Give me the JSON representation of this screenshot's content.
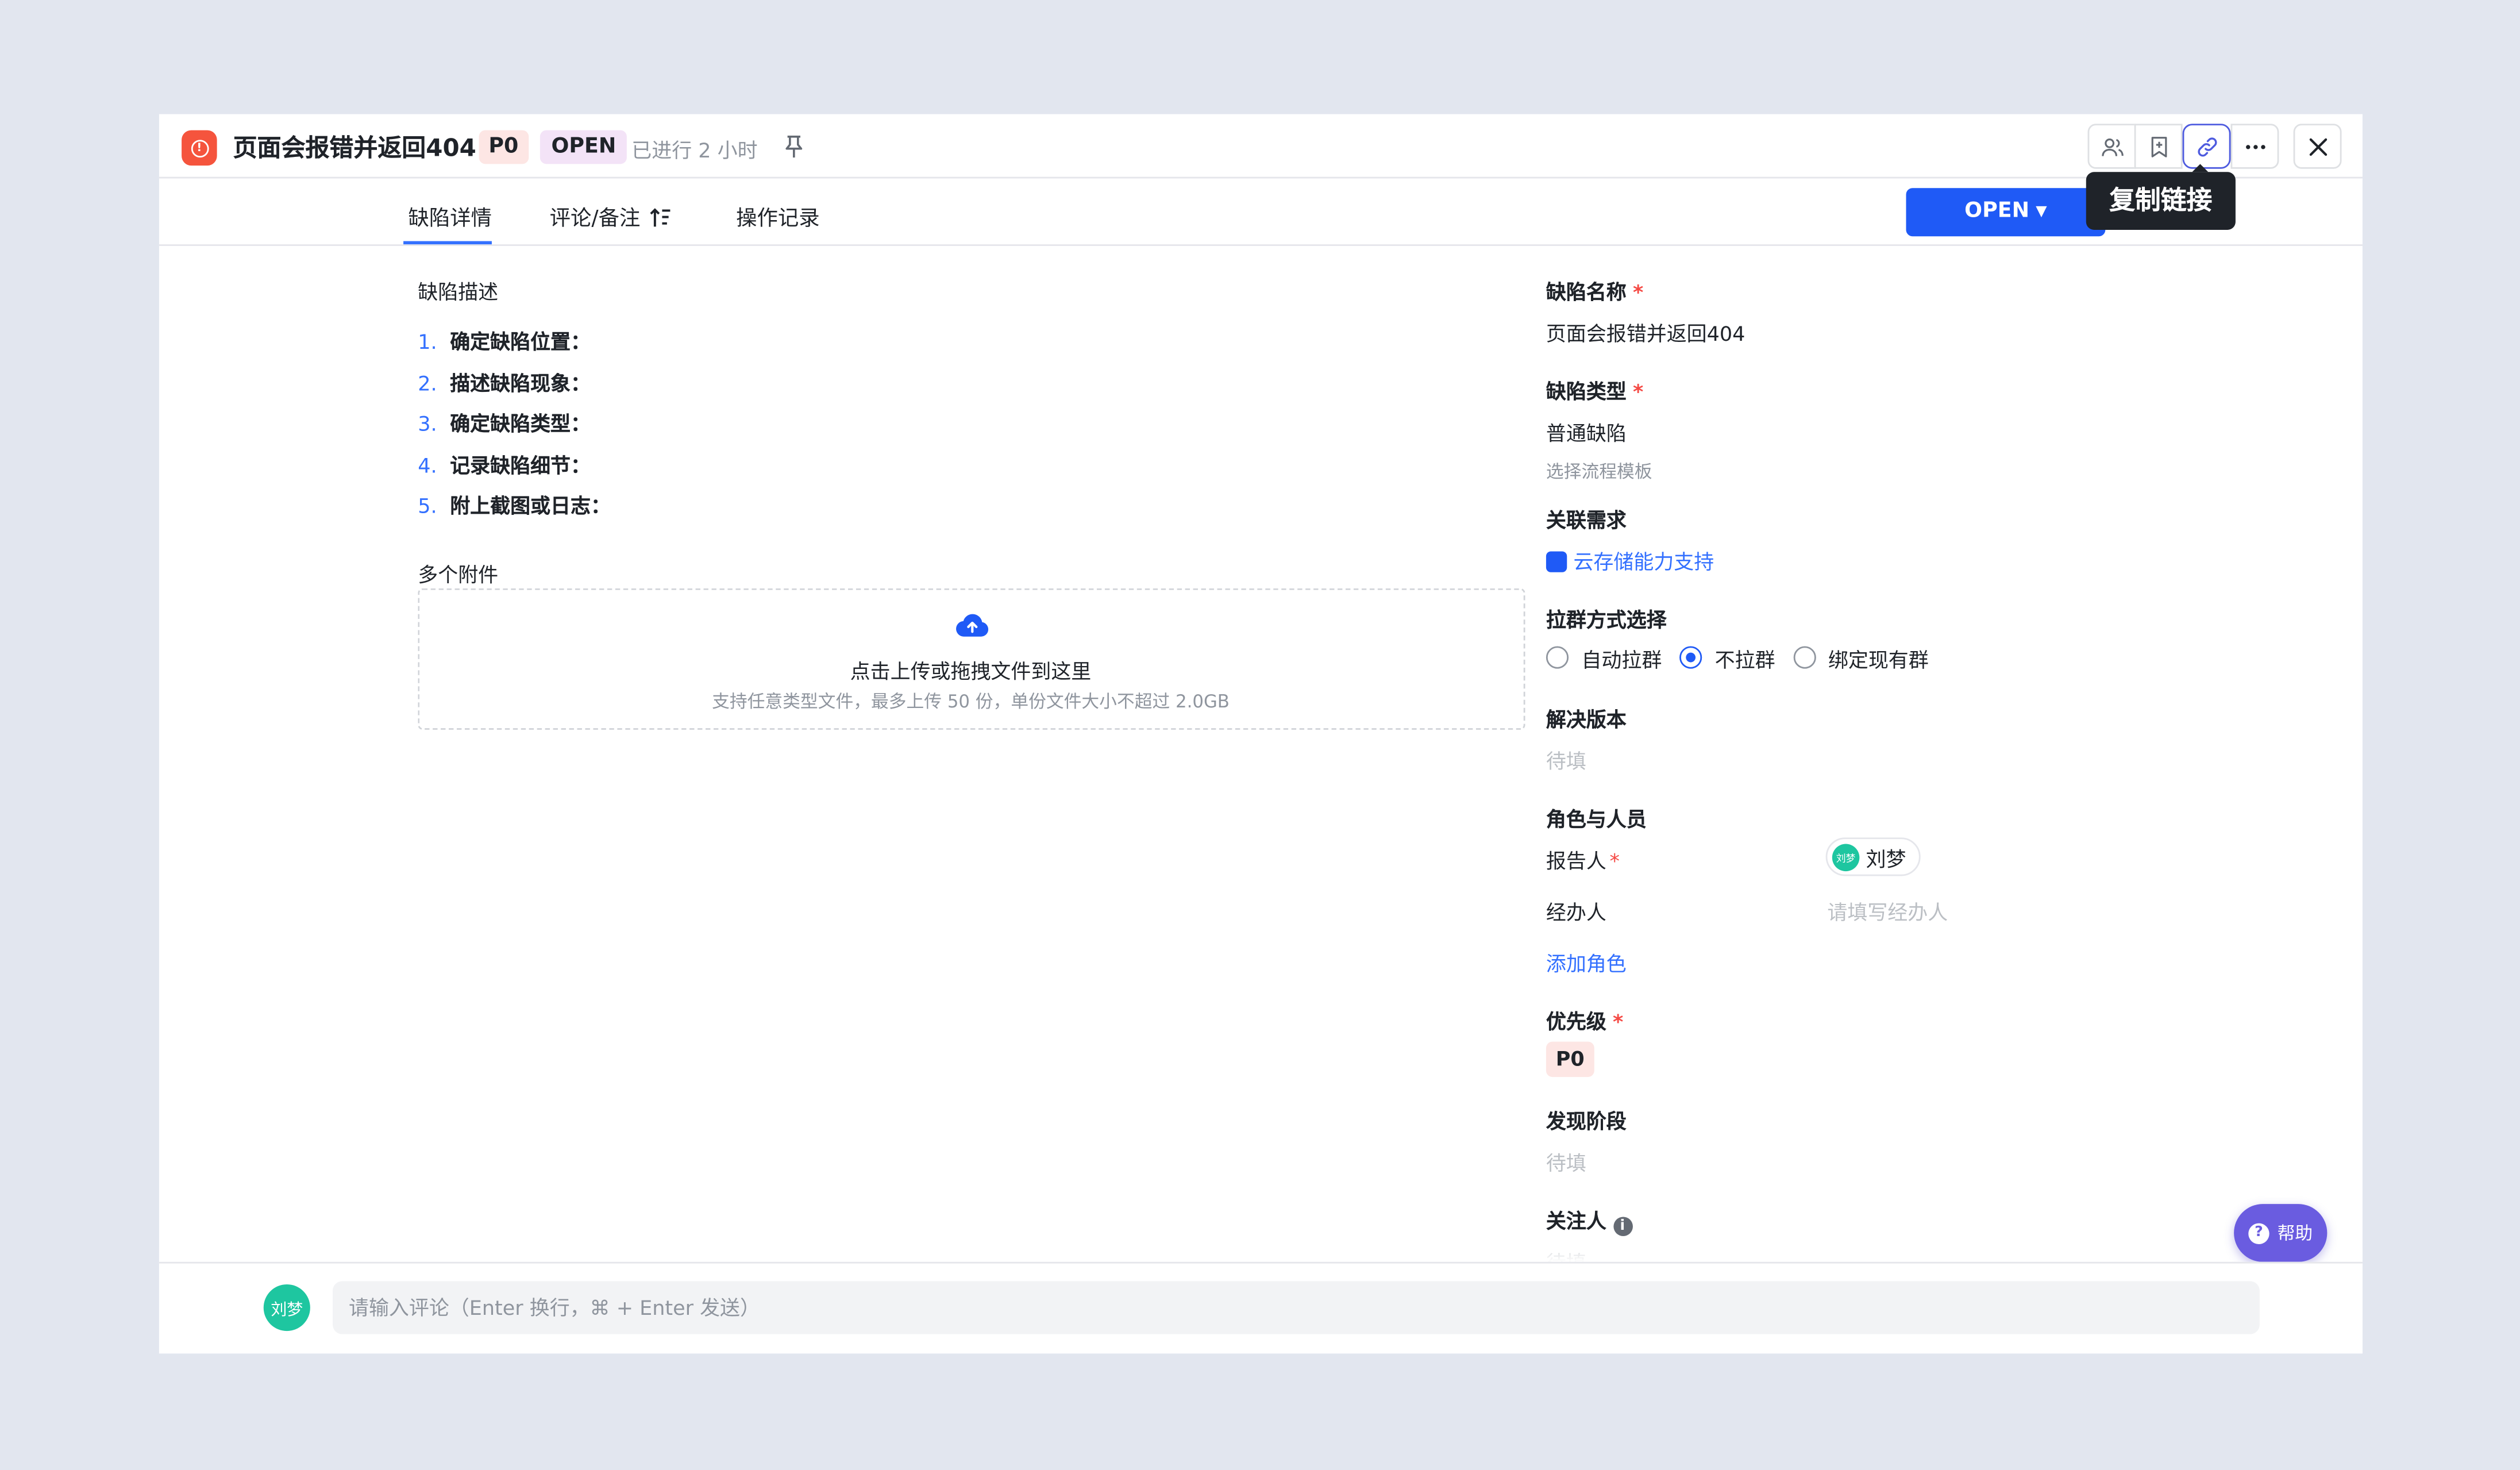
{
  "header": {
    "title": "页面会报错并返回404",
    "priority_tag": "P0",
    "status_tag": "OPEN",
    "elapsed": "已进行 2 小时",
    "tooltip": "复制链接",
    "icons": [
      "bug-icon",
      "pin-icon",
      "members-icon",
      "bookmark-icon",
      "link-icon",
      "more-icon",
      "close-icon"
    ]
  },
  "tabs": [
    {
      "label": "缺陷详情",
      "active": true
    },
    {
      "label": "评论/备注",
      "active": false
    },
    {
      "label": "操作记录",
      "active": false
    }
  ],
  "status_button": {
    "label": "OPEN",
    "caret": "▼",
    "color": "#1f5af6"
  },
  "description": {
    "label": "缺陷描述",
    "steps": [
      {
        "num": "1.",
        "text": "确定缺陷位置："
      },
      {
        "num": "2.",
        "text": "描述缺陷现象："
      },
      {
        "num": "3.",
        "text": "确定缺陷类型："
      },
      {
        "num": "4.",
        "text": "记录缺陷细节："
      },
      {
        "num": "5.",
        "text": "附上截图或日志："
      }
    ]
  },
  "attachments": {
    "label": "多个附件",
    "upload_title": "点击上传或拖拽文件到这里",
    "upload_hint": "支持任意类型文件，最多上传 50 份，单份文件大小不超过 2.0GB"
  },
  "fields": {
    "name_label": "缺陷名称",
    "name_value": "页面会报错并返回404",
    "type_label": "缺陷类型",
    "type_value": "普通缺陷",
    "template_hint": "选择流程模板",
    "requirement_label": "关联需求",
    "requirement_value": "云存储能力支持",
    "group_label": "拉群方式选择",
    "group_options": [
      {
        "label": "自动拉群",
        "checked": false
      },
      {
        "label": "不拉群",
        "checked": true
      },
      {
        "label": "绑定现有群",
        "checked": false
      }
    ],
    "version_label": "解决版本",
    "version_placeholder": "待填",
    "roles_label": "角色与人员",
    "reporter_label": "报告人",
    "reporter_name": "刘梦",
    "reporter_initials": "刘梦",
    "assignee_label": "经办人",
    "assignee_placeholder": "请填写经办人",
    "add_role": "添加角色",
    "priority_label": "优先级",
    "priority_value": "P0",
    "stage_label": "发现阶段",
    "stage_placeholder": "待填",
    "followers_label": "关注人",
    "followers_placeholder": "待填",
    "required_mark": "*"
  },
  "help": {
    "label": "帮助",
    "icon": "?"
  },
  "footer": {
    "avatar_text": "刘梦",
    "comment_placeholder": "请输入评论（Enter 换行，⌘ + Enter 发送）"
  },
  "colors": {
    "accent": "#1f5af6",
    "link": "#3370ff",
    "danger": "#f54a45",
    "bug": "#f5543d",
    "avatar": "#1ec6a0",
    "help": "#6a5ce0"
  }
}
